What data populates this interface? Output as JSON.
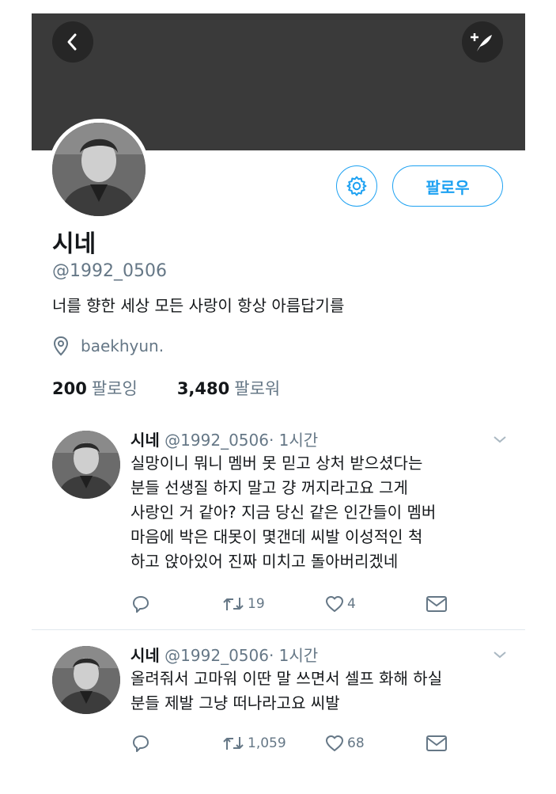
{
  "profile": {
    "name": "시네",
    "handle": "@1992_0506",
    "bio": "너를 향한 세상 모든 사랑이 항상 아름답기를",
    "location": "baekhyun.",
    "following_count": "200",
    "following_label": "팔로잉",
    "followers_count": "3,480",
    "followers_label": "팔로워",
    "follow_button": "팔로우"
  },
  "colors": {
    "accent": "#1da1f2",
    "banner": "#3a3a3a",
    "secondary_text": "#657786"
  },
  "icons": [
    "back-arrow-icon",
    "compose-tweet-icon",
    "gear-icon",
    "location-pin-icon",
    "reply-icon",
    "retweet-icon",
    "like-icon",
    "message-icon",
    "chevron-down-icon"
  ],
  "tweets": [
    {
      "name": "시네",
      "handle": "@1992_0506",
      "time": "· 1시간",
      "text": "실망이니 뭐니 멤버 못 믿고 상처 받으셨다는\n분들 선생질 하지 말고 걍 꺼지라고요 그게\n사랑인 거 같아? 지금 당신 같은 인간들이 멤버\n마음에 박은 대못이 몇갠데 씨발 이성적인 척\n하고 앉아있어 진짜 미치고 돌아버리겠네",
      "retweets": "19",
      "likes": "4"
    },
    {
      "name": "시네",
      "handle": "@1992_0506",
      "time": "· 1시간",
      "text": "올려줘서 고마워 이딴 말 쓰면서 셀프 화해 하실\n분들 제발 그냥 떠나라고요 씨발",
      "retweets": "1,059",
      "likes": "68"
    }
  ]
}
